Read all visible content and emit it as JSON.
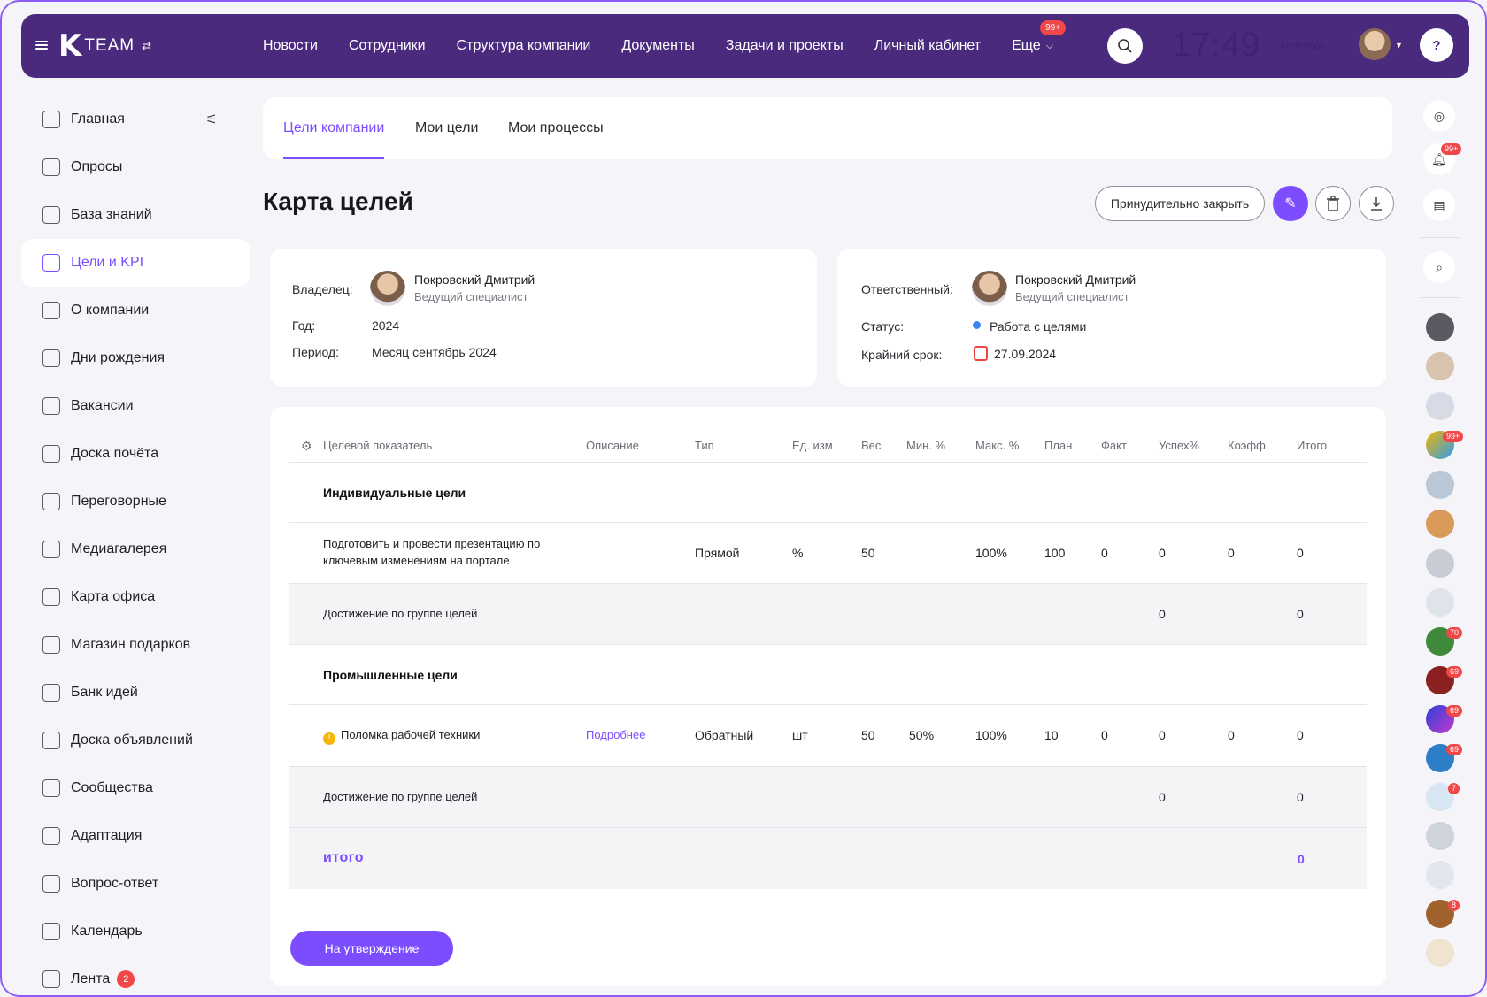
{
  "topbar": {
    "logo_letter": "K",
    "logo_text": "TEAM",
    "nav": [
      "Новости",
      "Сотрудники",
      "Структура компании",
      "Документы",
      "Задачи и проекты",
      "Личный кабинет"
    ],
    "more_label": "Еще",
    "more_badge": "99+",
    "clock": "17:49",
    "clock_sub": "сентябрь",
    "help": "?"
  },
  "sidebar": {
    "items": [
      {
        "label": "Главная"
      },
      {
        "label": "Опросы"
      },
      {
        "label": "База знаний"
      },
      {
        "label": "Цели и KPI"
      },
      {
        "label": "О компании"
      },
      {
        "label": "Дни рождения"
      },
      {
        "label": "Вакансии"
      },
      {
        "label": "Доска почёта"
      },
      {
        "label": "Переговорные"
      },
      {
        "label": "Медиагалерея"
      },
      {
        "label": "Карта офиса"
      },
      {
        "label": "Магазин подарков"
      },
      {
        "label": "Банк идей"
      },
      {
        "label": "Доска объявлений"
      },
      {
        "label": "Сообщества"
      },
      {
        "label": "Адаптация"
      },
      {
        "label": "Вопрос-ответ"
      },
      {
        "label": "Календарь"
      },
      {
        "label": "Лента",
        "badge": "2"
      }
    ]
  },
  "tabs": [
    "Цели компании",
    "Мои цели",
    "Мои процессы"
  ],
  "page": {
    "title": "Карта целей",
    "close_button": "Принудительно закрыть",
    "approve_button": "На утверждение"
  },
  "owner_card": {
    "owner_label": "Владелец:",
    "owner_name": "Покровский Дмитрий",
    "owner_role": "Ведущий специалист",
    "year_label": "Год:",
    "year": "2024",
    "period_label": "Период:",
    "period": "Месяц сентябрь 2024"
  },
  "resp_card": {
    "resp_label": "Ответственный:",
    "resp_name": "Покровский Дмитрий",
    "resp_role": "Ведущий специалист",
    "status_label": "Статус:",
    "status": "Работа с целями",
    "deadline_label": "Крайний срок:",
    "deadline": "27.09.2024"
  },
  "table": {
    "headers": [
      "Целевой показатель",
      "Описание",
      "Тип",
      "Ед. изм",
      "Вес",
      "Мин. %",
      "Макс. %",
      "План",
      "Факт",
      "Успех%",
      "Коэфф.",
      "Итого"
    ],
    "group1": {
      "title": "Индивидуальные цели",
      "row": {
        "name_line1": "Подготовить и провести презентацию по",
        "name_line2": "ключевым изменениям на портале",
        "desc": "",
        "type": "Прямой",
        "unit": "%",
        "weight": "50",
        "min": "",
        "max": "100%",
        "plan": "100",
        "fact": "0",
        "success": "0",
        "coef": "0",
        "total": "0"
      },
      "achievement_label": "Достижение по группе целей",
      "achievement_success": "0",
      "achievement_total": "0"
    },
    "group2": {
      "title": "Промышленные цели",
      "row": {
        "name": "Поломка рабочей техники",
        "desc": "Подробнее",
        "type": "Обратный",
        "unit": "шт",
        "weight": "50",
        "min": "50%",
        "max": "100%",
        "plan": "10",
        "fact": "0",
        "success": "0",
        "coef": "0",
        "total": "0"
      },
      "achievement_label": "Достижение по группе целей",
      "achievement_success": "0",
      "achievement_total": "0"
    },
    "total_label": "итого",
    "total_value": "0"
  },
  "rail": {
    "badges": [
      "99+",
      "99+",
      "70",
      "69",
      "69",
      "69",
      "7",
      "8"
    ]
  },
  "colors": {
    "accent": "#7c4dff",
    "topbar": "#4a2a7d",
    "badge": "#f04848"
  }
}
